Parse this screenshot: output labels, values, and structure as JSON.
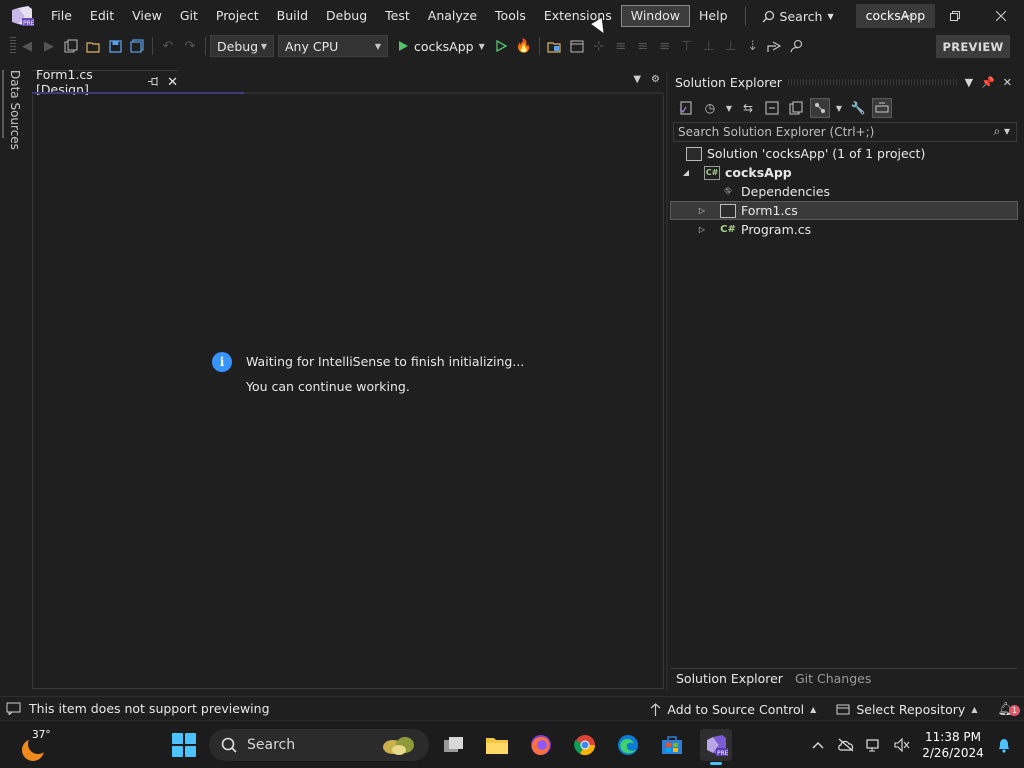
{
  "titlebar": {
    "menu": [
      "File",
      "Edit",
      "View",
      "Git",
      "Project",
      "Build",
      "Debug",
      "Test",
      "Analyze",
      "Tools",
      "Extensions",
      "Window",
      "Help"
    ],
    "active_menu_index": 11,
    "search_label": "Search",
    "app_title": "cocksApp"
  },
  "toolbar": {
    "config": "Debug",
    "platform": "Any CPU",
    "run_target": "cocksApp",
    "preview_label": "PREVIEW"
  },
  "left_strip": {
    "data_sources_label": "Data Sources"
  },
  "document": {
    "tab_title": "Form1.cs [Design]",
    "info_line1": "Waiting for IntelliSense to finish initializing...",
    "info_line2": "You can continue working."
  },
  "solution_explorer": {
    "title": "Solution Explorer",
    "search_placeholder": "Search Solution Explorer (Ctrl+;)",
    "tree": {
      "solution": "Solution 'cocksApp' (1 of 1 project)",
      "project": "cocksApp",
      "dependencies": "Dependencies",
      "form1": "Form1.cs",
      "program": "Program.cs"
    },
    "bottom_tabs": [
      "Solution Explorer",
      "Git Changes"
    ]
  },
  "statusbar": {
    "message": "This item does not support previewing",
    "add_source_control": "Add to Source Control",
    "select_repository": "Select Repository",
    "notification_count": "1"
  },
  "taskbar": {
    "temperature": "37°",
    "search_label": "Search",
    "time": "11:38 PM",
    "date": "2/26/2024"
  },
  "colors": {
    "background": "#1f1f1f",
    "accent_blue": "#3794ff",
    "run_green": "#4fc46a",
    "windows_blue": "#4cc2ff"
  }
}
